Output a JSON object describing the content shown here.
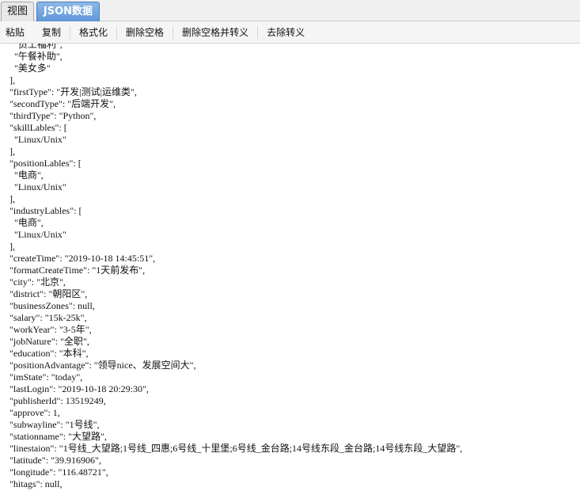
{
  "tabs": [
    {
      "label": "视图"
    },
    {
      "label": "JSON数据"
    }
  ],
  "toolbar": {
    "buttons": [
      "粘贴",
      "复制",
      "格式化",
      "删除空格",
      "删除空格并转义",
      "去除转义"
    ]
  },
  "code_lines": [
    "      \"员工福利\",",
    "      \"午餐补助\",",
    "      \"美女多\"",
    "    ],",
    "    \"firstType\": \"开发|测试|运维类\",",
    "    \"secondType\": \"后端开发\",",
    "    \"thirdType\": \"Python\",",
    "    \"skillLables\": [",
    "      \"Linux/Unix\"",
    "    ],",
    "    \"positionLables\": [",
    "      \"电商\",",
    "      \"Linux/Unix\"",
    "    ],",
    "    \"industryLables\": [",
    "      \"电商\",",
    "      \"Linux/Unix\"",
    "    ],",
    "    \"createTime\": \"2019-10-18 14:45:51\",",
    "    \"formatCreateTime\": \"1天前发布\",",
    "    \"city\": \"北京\",",
    "    \"district\": \"朝阳区\",",
    "    \"businessZones\": null,",
    "    \"salary\": \"15k-25k\",",
    "    \"workYear\": \"3-5年\",",
    "    \"jobNature\": \"全职\",",
    "    \"education\": \"本科\",",
    "    \"positionAdvantage\": \"领导nice、发展空间大\",",
    "    \"imState\": \"today\",",
    "    \"lastLogin\": \"2019-10-18 20:29:30\",",
    "    \"publisherId\": 13519249,",
    "    \"approve\": 1,",
    "    \"subwayline\": \"1号线\",",
    "    \"stationname\": \"大望路\",",
    "    \"linestaion\": \"1号线_大望路;1号线_四惠;6号线_十里堡;6号线_金台路;14号线东段_金台路;14号线东段_大望路\",",
    "    \"latitude\": \"39.916906\",",
    "    \"longitude\": \"116.48721\",",
    "    \"hitags\": null,"
  ]
}
